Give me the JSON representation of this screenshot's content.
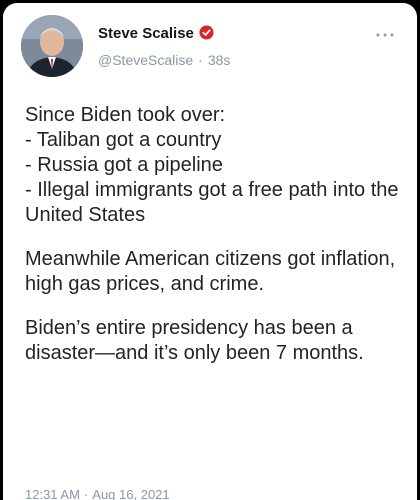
{
  "author": {
    "display_name": "Steve Scalise",
    "handle": "@SteveScalise",
    "separator": "·",
    "relative_time": "38s",
    "verified_icon": "verified-badge-icon",
    "avatar": "profile-photo"
  },
  "menu": {
    "icon": "more-options-icon"
  },
  "tweet": {
    "paragraphs": [
      "Since Biden took over:\n- Taliban got a country\n- Russia got a pipeline\n- Illegal immigrants got a free path into the United States",
      "Meanwhile American citizens got inflation, high gas prices, and crime.",
      "Biden’s entire presidency has been a disaster—and it’s only been 7 months."
    ]
  },
  "footer": {
    "time": "12:31 AM",
    "separator": "·",
    "date": "Aug 16, 2021"
  },
  "colors": {
    "background": "#000000",
    "card": "#ffffff",
    "text": "#1f2328",
    "muted": "#8b98a5",
    "verified_red": "#d6272b"
  }
}
